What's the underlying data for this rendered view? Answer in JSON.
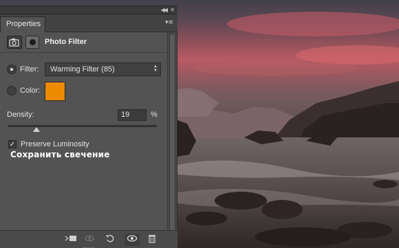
{
  "panel": {
    "tab_label": "Properties",
    "adjustment_title": "Photo Filter"
  },
  "filter": {
    "label": "Filter:",
    "selected": "Warming Filter (85)",
    "selected_mode": true
  },
  "color": {
    "label": "Color:",
    "swatch_color": "#ec8a00"
  },
  "density": {
    "label": "Density:",
    "value": "19",
    "unit": "%",
    "slider_value_percent": 19
  },
  "preserve_luminosity": {
    "label": "Preserve Luminosity",
    "checked": true
  },
  "overlay_caption": "Сохранить свечение",
  "icons": {
    "titlebar": [
      "collapse-icon",
      "close-icon"
    ],
    "panel_menu": "panel-menu-icon",
    "header": [
      "photo-filter-adjustment-icon",
      "layer-mask-icon"
    ],
    "footer": [
      "clip-to-layer-icon",
      "view-previous-state-icon",
      "reset-icon",
      "visibility-eye-icon",
      "trash-icon"
    ]
  },
  "colors": {
    "panel_bg": "#535353",
    "accent_swatch": "#ec8a00"
  }
}
